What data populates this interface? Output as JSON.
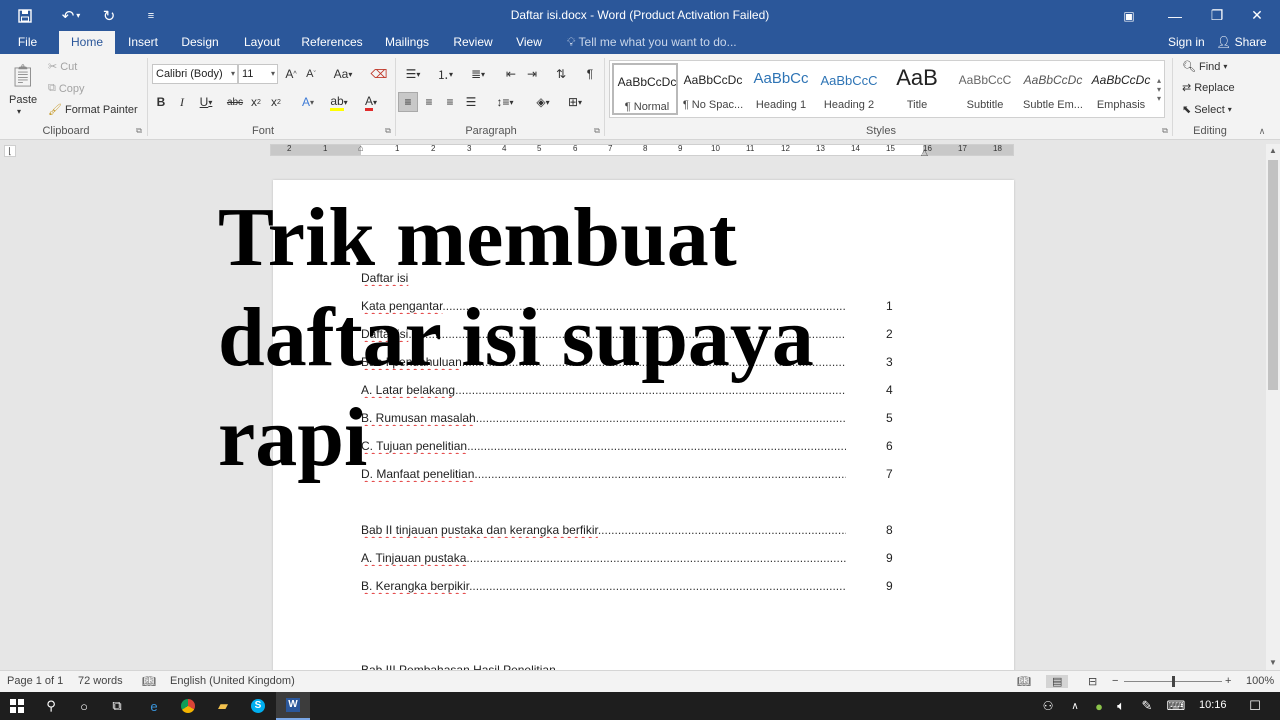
{
  "window": {
    "title": "Daftar isi.docx - Word (Product Activation Failed)"
  },
  "tabs": [
    {
      "label": "File"
    },
    {
      "label": "Home"
    },
    {
      "label": "Insert"
    },
    {
      "label": "Design"
    },
    {
      "label": "Layout"
    },
    {
      "label": "References"
    },
    {
      "label": "Mailings"
    },
    {
      "label": "Review"
    },
    {
      "label": "View"
    }
  ],
  "tell_me": {
    "placeholder": "Tell me what you want to do..."
  },
  "account": {
    "sign_in": "Sign in",
    "share": "Share"
  },
  "clipboard": {
    "paste": "Paste",
    "cut": "Cut",
    "copy": "Copy",
    "format_painter": "Format Painter",
    "label": "Clipboard"
  },
  "font": {
    "name": "Calibri (Body)",
    "size": "11",
    "label": "Font"
  },
  "paragraph": {
    "label": "Paragraph"
  },
  "styles": {
    "label": "Styles",
    "items": [
      {
        "sample": "AaBbCcDc",
        "name": "¶ Normal"
      },
      {
        "sample": "AaBbCcDc",
        "name": "¶ No Spac..."
      },
      {
        "sample": "AaBbCc",
        "name": "Heading 1"
      },
      {
        "sample": "AaBbCcC",
        "name": "Heading 2"
      },
      {
        "sample": "AaB",
        "name": "Title"
      },
      {
        "sample": "AaBbCcC",
        "name": "Subtitle"
      },
      {
        "sample": "AaBbCcDc",
        "name": "Subtle Em..."
      },
      {
        "sample": "AaBbCcDc",
        "name": "Emphasis"
      }
    ]
  },
  "editing": {
    "find": "Find",
    "replace": "Replace",
    "select": "Select",
    "label": "Editing"
  },
  "ruler": {
    "labels": [
      "2",
      "1",
      "1",
      "2",
      "3",
      "4",
      "5",
      "6",
      "7",
      "8",
      "9",
      "10",
      "11",
      "12",
      "13",
      "14",
      "15",
      "16",
      "17",
      "18"
    ]
  },
  "document": {
    "heading": "Daftar isi",
    "toc": [
      {
        "text": "Kata pengantar",
        "page": "1"
      },
      {
        "text": "Daftar isi",
        "page": "2"
      },
      {
        "text": "Bab I pendahuluan",
        "page": "3"
      },
      {
        "text": "A. Latar belakang",
        "page": "4"
      },
      {
        "text": "B. Rumusan masalah",
        "page": "5"
      },
      {
        "text": "C. Tujuan penelitian",
        "page": "6"
      },
      {
        "text": "D. Manfaat penelitian",
        "page": "7"
      },
      {
        "text": "Bab II tinjauan pustaka dan kerangka berfikir",
        "page": "8"
      },
      {
        "text": "A. Tinjauan pustaka",
        "page": "9"
      },
      {
        "text": "B. Kerangka berpikir",
        "page": "9"
      }
    ],
    "next_line": "Bab III Pembahasan Hasil Penelitian"
  },
  "overlay": {
    "line1": "Trik membuat",
    "line2": "daftar isi supaya",
    "line3": "rapi"
  },
  "status": {
    "page": "Page 1 of 1",
    "words": "72 words",
    "language": "English (United Kingdom)",
    "zoom": "100%"
  },
  "taskbar": {
    "time": "10:16"
  }
}
